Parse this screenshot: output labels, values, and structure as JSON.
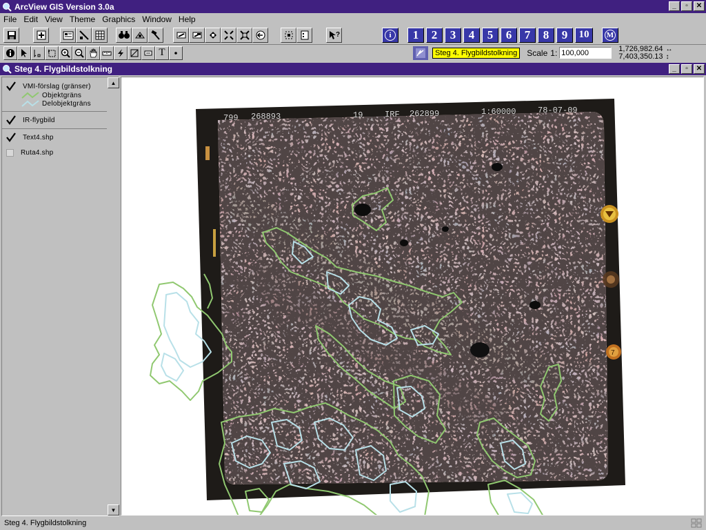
{
  "app": {
    "title": "ArcView GIS Version 3.0a",
    "titlebar_color": "#402080"
  },
  "menu": {
    "items": [
      {
        "label": "File"
      },
      {
        "label": "Edit"
      },
      {
        "label": "View"
      },
      {
        "label": "Theme"
      },
      {
        "label": "Graphics"
      },
      {
        "label": "Window"
      },
      {
        "label": "Help"
      }
    ]
  },
  "toolbar": {
    "buttons": [
      {
        "icon": "save-project-icon"
      },
      {
        "icon": "add-theme-icon"
      },
      {
        "icon": "theme-properties-icon"
      },
      {
        "icon": "edit-legend-icon"
      },
      {
        "icon": "open-table-icon"
      },
      {
        "icon": "find-icon"
      },
      {
        "icon": "locate-address-icon"
      },
      {
        "icon": "query-builder-icon"
      },
      {
        "icon": "zoom-full-extent-icon"
      },
      {
        "icon": "zoom-active-themes-icon"
      },
      {
        "icon": "zoom-selected-icon"
      },
      {
        "icon": "zoom-in-icon"
      },
      {
        "icon": "zoom-out-icon"
      },
      {
        "icon": "zoom-previous-icon"
      },
      {
        "icon": "select-by-theme-icon"
      },
      {
        "icon": "clear-selection-icon"
      },
      {
        "icon": "help-icon"
      }
    ],
    "step_buttons": [
      "1",
      "2",
      "3",
      "4",
      "5",
      "6",
      "7",
      "8",
      "9",
      "10"
    ],
    "info_button": "i",
    "menu_button": "M",
    "step_color": "#3838a8"
  },
  "tools": {
    "items": [
      {
        "icon": "identify-icon"
      },
      {
        "icon": "pointer-icon"
      },
      {
        "icon": "vertex-edit-icon"
      },
      {
        "icon": "select-feature-icon"
      },
      {
        "icon": "zoom-in-tool-icon"
      },
      {
        "icon": "zoom-out-tool-icon"
      },
      {
        "icon": "pan-hand-icon"
      },
      {
        "icon": "measure-icon"
      },
      {
        "icon": "hotlink-icon"
      },
      {
        "icon": "area-of-interest-icon"
      },
      {
        "icon": "label-icon"
      },
      {
        "icon": "text-tool-icon",
        "glyph": "T"
      },
      {
        "icon": "draw-point-icon"
      }
    ],
    "active_view_badge": "Steg 4. Flygbildstolkning",
    "badge_color": "#ffff00",
    "scale_label": "Scale",
    "scale_prefix": "1:",
    "scale_value": "100,000",
    "coord_x": "1,726,982.64",
    "coord_y": "7,403,350.13"
  },
  "view": {
    "title": "Steg 4. Flygbildstolkning",
    "toc": {
      "themes": [
        {
          "name": "VMI-förslag (gränser)",
          "visible": true,
          "legend": [
            {
              "label": "Objektgräns",
              "color": "#90c870"
            },
            {
              "label": "Delobjektgräns",
              "color": "#b8e0e8"
            }
          ]
        },
        {
          "name": "IR-flygbild",
          "visible": true
        },
        {
          "name": "Text4.shp",
          "visible": true
        },
        {
          "name": "Ruta4.shp",
          "visible": false
        }
      ]
    },
    "photo_annotation": {
      "left_id": "799",
      "frame": "268893",
      "lens": "19",
      "code": "IRF",
      "frame2": "262899",
      "scale": "1:60000",
      "date": "78-07-09"
    },
    "photo_clock_mark": "7"
  },
  "status": {
    "text": "Steg 4. Flygbildstolkning"
  }
}
